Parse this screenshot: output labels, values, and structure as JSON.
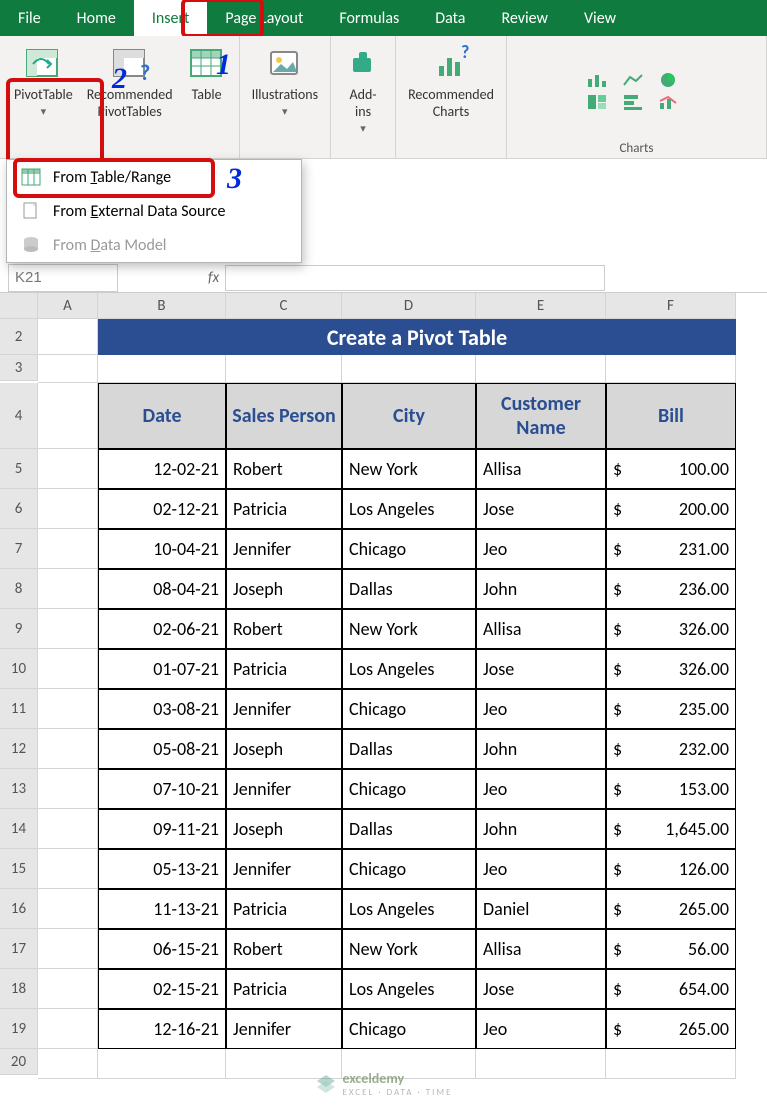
{
  "tabs": [
    "File",
    "Home",
    "Insert",
    "Page Layout",
    "Formulas",
    "Data",
    "Review",
    "View"
  ],
  "active_tab_index": 2,
  "callouts": {
    "c1": "1",
    "c2": "2",
    "c3": "3"
  },
  "ribbon": {
    "tables": {
      "pivot": "PivotTable",
      "recommended": "Recommended\nPivotTables",
      "table": "Table"
    },
    "illustrations": "Illustrations",
    "addins": "Add-\nins",
    "recommended_charts": "Recommended\nCharts",
    "charts_label": "Charts"
  },
  "dropdown": {
    "from_table": "From Table/Range",
    "from_ext": "From External Data Source",
    "from_model": "From Data Model"
  },
  "name_box": "K21",
  "fx": "fx",
  "columns": [
    "A",
    "B",
    "C",
    "D",
    "E",
    "F"
  ],
  "row_start": 2,
  "row_end": 20,
  "title_cell": "Create a Pivot Table",
  "headers": [
    "Date",
    "Sales Person",
    "City",
    "Customer Name",
    "Bill"
  ],
  "currency": "$",
  "chart_data": {
    "type": "table",
    "columns": [
      "Date",
      "Sales Person",
      "City",
      "Customer Name",
      "Bill"
    ],
    "rows": [
      [
        "12-02-21",
        "Robert",
        "New York",
        "Allisa",
        "100.00"
      ],
      [
        "02-12-21",
        "Patricia",
        "Los Angeles",
        "Jose",
        "200.00"
      ],
      [
        "10-04-21",
        "Jennifer",
        "Chicago",
        "Jeo",
        "231.00"
      ],
      [
        "08-04-21",
        "Joseph",
        "Dallas",
        "John",
        "236.00"
      ],
      [
        "02-06-21",
        "Robert",
        "New York",
        "Allisa",
        "326.00"
      ],
      [
        "01-07-21",
        "Patricia",
        "Los Angeles",
        "Jose",
        "326.00"
      ],
      [
        "03-08-21",
        "Jennifer",
        "Chicago",
        "Jeo",
        "235.00"
      ],
      [
        "05-08-21",
        "Joseph",
        "Dallas",
        "John",
        "232.00"
      ],
      [
        "07-10-21",
        "Jennifer",
        "Chicago",
        "Jeo",
        "153.00"
      ],
      [
        "09-11-21",
        "Joseph",
        "Dallas",
        "John",
        "1,645.00"
      ],
      [
        "05-13-21",
        "Jennifer",
        "Chicago",
        "Jeo",
        "126.00"
      ],
      [
        "11-13-21",
        "Patricia",
        "Los Angeles",
        "Daniel",
        "265.00"
      ],
      [
        "06-15-21",
        "Robert",
        "New York",
        "Allisa",
        "56.00"
      ],
      [
        "02-15-21",
        "Patricia",
        "Los Angeles",
        "Jose",
        "654.00"
      ],
      [
        "12-16-21",
        "Jennifer",
        "Chicago",
        "Jeo",
        "265.00"
      ]
    ]
  },
  "watermark": {
    "brand": "exceldemy",
    "tag": "EXCEL · DATA · TIME"
  }
}
